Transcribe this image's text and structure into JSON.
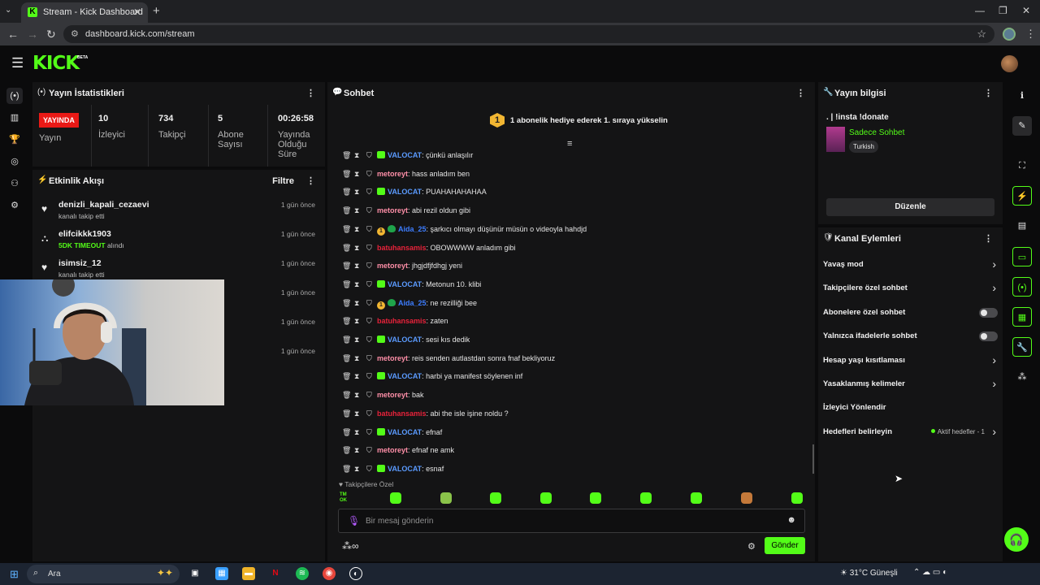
{
  "browser": {
    "tab_title": "Stream - Kick Dashboard",
    "tab_favicon": "K",
    "url": "dashboard.kick.com/stream"
  },
  "header": {
    "logo": "KICK",
    "beta": "BETA"
  },
  "stats": {
    "title": "Yayın İstatistikleri",
    "live_badge": "YAYINDA",
    "live_label": "Yayın",
    "viewers_value": "10",
    "viewers_label": "İzleyici",
    "followers_value": "734",
    "followers_label": "Takipçi",
    "subs_value": "5",
    "subs_label": "Abone Sayısı",
    "duration_value": "00:26:58",
    "duration_label": "Yayında Olduğu Süre"
  },
  "activity": {
    "title": "Etkinlik Akışı",
    "filter": "Filtre",
    "items": [
      {
        "name": "denizli_kapali_cezaevi",
        "desc": "kanalı takip etti",
        "time": "1 gün önce"
      },
      {
        "name": "elifcikkk1903",
        "desc_strong": "5DK TIMEOUT",
        "desc": "alındı",
        "time": "1 gün önce"
      },
      {
        "name": "isimsiz_12",
        "desc": "kanalı takip etti",
        "time": "1 gün önce"
      },
      {
        "time": "1 gün önce"
      },
      {
        "time": "1 gün önce"
      },
      {
        "time": "1 gün önce"
      }
    ]
  },
  "chat": {
    "title": "Sohbet",
    "pinned_badge": "1",
    "pinned_text": "1 abonelik hediye ederek 1. sıraya yükselin",
    "messages": [
      {
        "user": "VALOCAT",
        "color": "#5b9bff",
        "badges": [
          "sub"
        ],
        "text": ": çünkü anlaşılır"
      },
      {
        "user": "metoreyt",
        "color": "#ff8fa8",
        "badges": [],
        "text": ": hass anladım ben"
      },
      {
        "user": "VALOCAT",
        "color": "#5b9bff",
        "badges": [
          "sub"
        ],
        "text": ": PUAHAHAHAHAA"
      },
      {
        "user": "metoreyt",
        "color": "#ff8fa8",
        "badges": [],
        "text": ": abi rezil oldun gibi"
      },
      {
        "user": "Aida_25",
        "color": "#3d7dff",
        "badges": [
          "gift",
          "frog"
        ],
        "text": ": şarkıcı olmayı düşünür müsün o videoyla hahdjd"
      },
      {
        "user": "batuhansamis",
        "color": "#e8223a",
        "badges": [],
        "text": ": OBOWWWW anladım gibi"
      },
      {
        "user": "metoreyt",
        "color": "#ff8fa8",
        "badges": [],
        "text": ": jhgjdfjfdhgj yeni"
      },
      {
        "user": "VALOCAT",
        "color": "#5b9bff",
        "badges": [
          "sub"
        ],
        "text": ": Metonun 10. klibi"
      },
      {
        "user": "Aida_25",
        "color": "#3d7dff",
        "badges": [
          "gift",
          "frog"
        ],
        "text": ": ne rezilliği bee"
      },
      {
        "user": "batuhansamis",
        "color": "#e8223a",
        "badges": [],
        "text": ": zaten"
      },
      {
        "user": "VALOCAT",
        "color": "#5b9bff",
        "badges": [
          "sub"
        ],
        "text": ": sesi kıs dedik"
      },
      {
        "user": "metoreyt",
        "color": "#ff8fa8",
        "badges": [],
        "text": ": reis senden autlastdan sonra fnaf bekliyoruz"
      },
      {
        "user": "VALOCAT",
        "color": "#5b9bff",
        "badges": [
          "sub"
        ],
        "text": ": harbi ya manifest söylenen inf"
      },
      {
        "user": "metoreyt",
        "color": "#ff8fa8",
        "badges": [],
        "text": ": bak"
      },
      {
        "user": "batuhansamis",
        "color": "#e8223a",
        "badges": [],
        "text": ": abi the isle işine noldu ?"
      },
      {
        "user": "VALOCAT",
        "color": "#5b9bff",
        "badges": [
          "sub"
        ],
        "text": ": efnaf"
      },
      {
        "user": "metoreyt",
        "color": "#ff8fa8",
        "badges": [],
        "text": ": efnaf ne amk"
      },
      {
        "user": "VALOCAT",
        "color": "#5b9bff",
        "badges": [
          "sub"
        ],
        "text": ": esnaf"
      }
    ],
    "follower_only": "Takipçilere Özel",
    "emote_first": "TM OK",
    "input_placeholder": "Bir mesaj gönderin",
    "send": "Gönder"
  },
  "stream_info": {
    "title": "Yayın bilgisi",
    "stream_title": ". | !insta !donate",
    "category": "Sadece Sohbet",
    "language": "Turkish",
    "edit": "Düzenle"
  },
  "channel_actions": {
    "title": "Kanal Eylemleri",
    "rows": [
      {
        "label": "Yavaş mod",
        "type": "chevron"
      },
      {
        "label": "Takipçilere özel sohbet",
        "type": "chevron"
      },
      {
        "label": "Abonelere özel sohbet",
        "type": "toggle"
      },
      {
        "label": "Yalnızca ifadelerle sohbet",
        "type": "toggle"
      },
      {
        "label": "Hesap yaşı kısıtlaması",
        "type": "chevron"
      },
      {
        "label": "Yasaklanmış kelimeler",
        "type": "chevron"
      },
      {
        "label": "İzleyici Yönlendir",
        "type": "none"
      },
      {
        "label": "Hedefleri belirleyin",
        "type": "chevron",
        "extra": "Aktif hedefler - 1"
      }
    ]
  },
  "taskbar": {
    "search_placeholder": "Ara",
    "weather": "31°C  Güneşli"
  },
  "colors": {
    "kick_green": "#53fc18",
    "live_red": "#e91916",
    "panel": "#141415"
  }
}
